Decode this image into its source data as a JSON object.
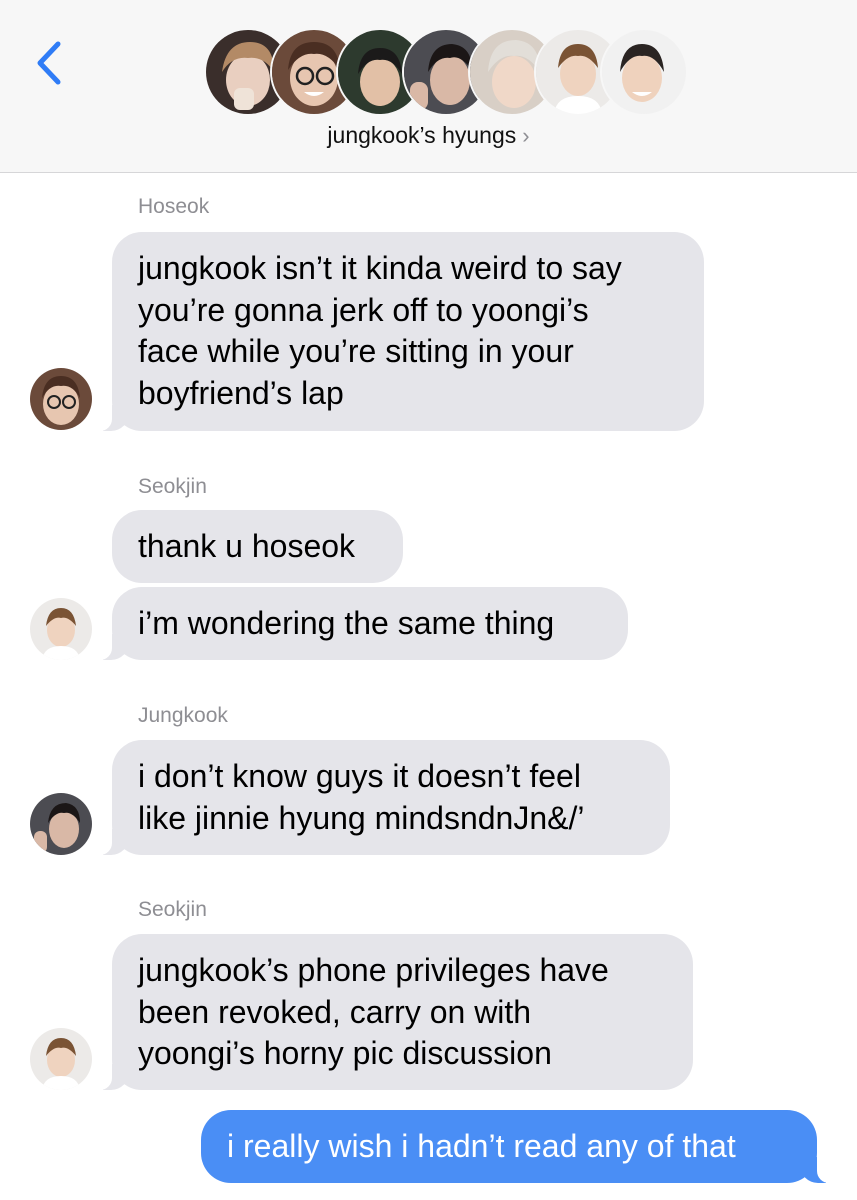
{
  "header": {
    "back_icon": "chevron-left-icon",
    "group_name": "jungkook’s hyungs",
    "chevron": "›",
    "avatars": [
      {
        "name": "yoongi",
        "bg": "#3a2e2b",
        "skin": "#e9cfc0",
        "hair": "#b38a66"
      },
      {
        "name": "hoseok",
        "bg": "#6b4a3a",
        "skin": "#e7c6b0",
        "hair": "#4a2e22"
      },
      {
        "name": "jimin",
        "bg": "#2d3a2e",
        "skin": "#e2c0a6",
        "hair": "#1b1a1a"
      },
      {
        "name": "jungkook",
        "bg": "#4c4c52",
        "skin": "#d9b8a6",
        "hair": "#1b1616"
      },
      {
        "name": "namjoon",
        "bg": "#d8cfc6",
        "skin": "#f0d8c8",
        "hair": "#e2ded8"
      },
      {
        "name": "seokjin",
        "bg": "#eceae8",
        "skin": "#efd3bf",
        "hair": "#7a5334"
      },
      {
        "name": "taehyung",
        "bg": "#f1f1f1",
        "skin": "#efd2bd",
        "hair": "#2a2422"
      }
    ]
  },
  "colors": {
    "received": "#e5e5ea",
    "sent": "#4a8ef5",
    "accent": "#2f7cf6"
  },
  "messages": {
    "hoseok_name": "Hoseok",
    "m1": "jungkook isn’t it kinda weird to say\nyou’re gonna jerk off to yoongi’s\nface while you’re sitting in your\nboyfriend’s lap",
    "seokjin_name_1": "Seokjin",
    "m2": "thank u hoseok",
    "m3": "i’m wondering the same thing",
    "jungkook_name": "Jungkook",
    "m4": "i don’t know guys it doesn’t feel\nlike jinnie hyung mindsndnJn&/’",
    "seokjin_name_2": "Seokjin",
    "m5": "jungkook’s phone privileges have\nbeen revoked, carry on with\nyoongi’s horny pic discussion",
    "m6": "i really wish i hadn’t read any of that"
  }
}
